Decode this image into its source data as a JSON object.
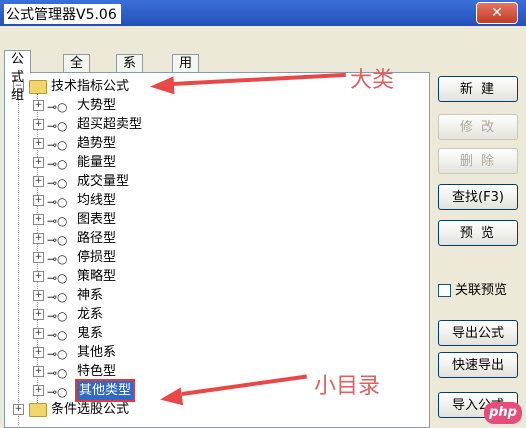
{
  "window": {
    "title": "公式管理器V5.06",
    "close_label": "✕"
  },
  "tabs": [
    "公式组",
    "全部",
    "系统",
    "用户"
  ],
  "tree": {
    "root": {
      "label": "技术指标公式",
      "expander": "−"
    },
    "children": [
      "大势型",
      "超买超卖型",
      "趋势型",
      "能量型",
      "成交量型",
      "均线型",
      "图表型",
      "路径型",
      "停损型",
      "策略型",
      "神系",
      "龙系",
      "鬼系",
      "其他系",
      "特色型",
      "其他类型"
    ],
    "selected": "其他类型",
    "next_root": {
      "label": "条件选股公式",
      "expander": "+"
    }
  },
  "buttons": {
    "new": "新 建",
    "edit": "修 改",
    "delete": "删 除",
    "find": "查找(F3)",
    "preview": "预 览",
    "export": "导出公式",
    "quick_export": "快速导出",
    "import": "导入公式"
  },
  "checkbox": {
    "label": "关联预览",
    "checked": false
  },
  "annotations": {
    "big_category": "大类",
    "small_category": "小目录"
  },
  "watermark": "php"
}
